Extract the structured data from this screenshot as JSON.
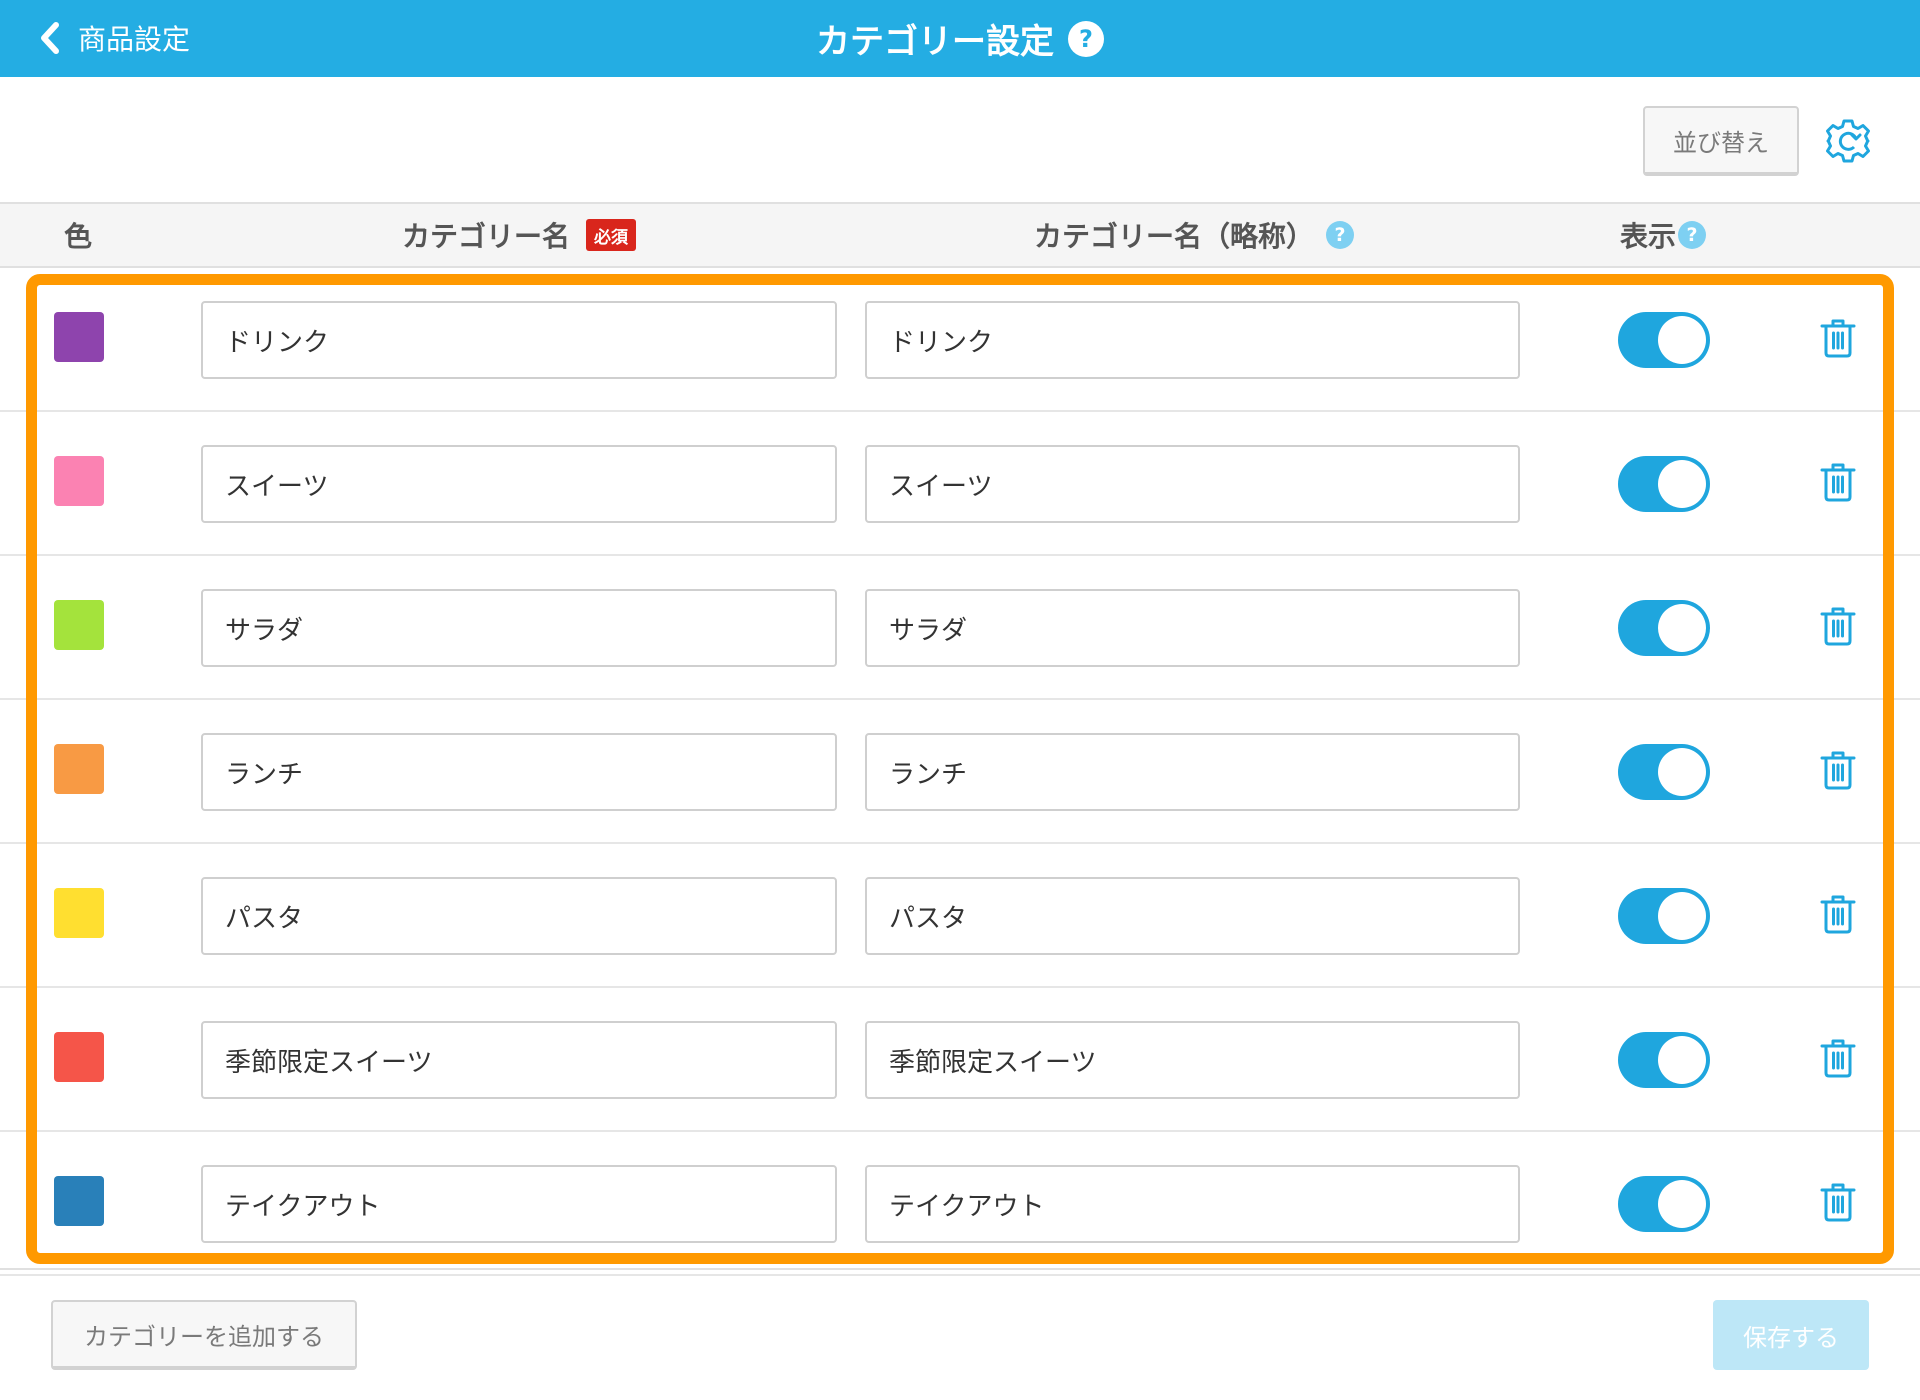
{
  "header": {
    "back_label": "商品設定",
    "title": "カテゴリー設定",
    "help_mark": "?"
  },
  "toolbar": {
    "sort_label": "並び替え"
  },
  "columns": {
    "color": "色",
    "name": "カテゴリー名",
    "required_badge": "必須",
    "abbr": "カテゴリー名（略称）",
    "display": "表示",
    "help_mark": "?"
  },
  "categories": [
    {
      "color": "#8E44AD",
      "name": "ドリンク",
      "abbr": "ドリンク",
      "visible": true
    },
    {
      "color": "#FB82B2",
      "name": "スイーツ",
      "abbr": "スイーツ",
      "visible": true
    },
    {
      "color": "#A4E33C",
      "name": "サラダ",
      "abbr": "サラダ",
      "visible": true
    },
    {
      "color": "#F89A44",
      "name": "ランチ",
      "abbr": "ランチ",
      "visible": true
    },
    {
      "color": "#FFDF30",
      "name": "パスタ",
      "abbr": "パスタ",
      "visible": true
    },
    {
      "color": "#F55549",
      "name": "季節限定スイーツ",
      "abbr": "季節限定スイーツ",
      "visible": true
    },
    {
      "color": "#2980B9",
      "name": "テイクアウト",
      "abbr": "テイクアウト",
      "visible": true
    }
  ],
  "footer": {
    "add_label": "カテゴリーを追加する",
    "save_label": "保存する"
  },
  "colors": {
    "header_bg": "#24ADE3",
    "toggle_on": "#1FA6DE",
    "highlight": "#FF9900",
    "required": "#D9261C"
  },
  "icons": {
    "back": "chevron-left-icon",
    "settings": "gear-icon",
    "delete": "trash-icon",
    "help": "question-circle-icon"
  }
}
